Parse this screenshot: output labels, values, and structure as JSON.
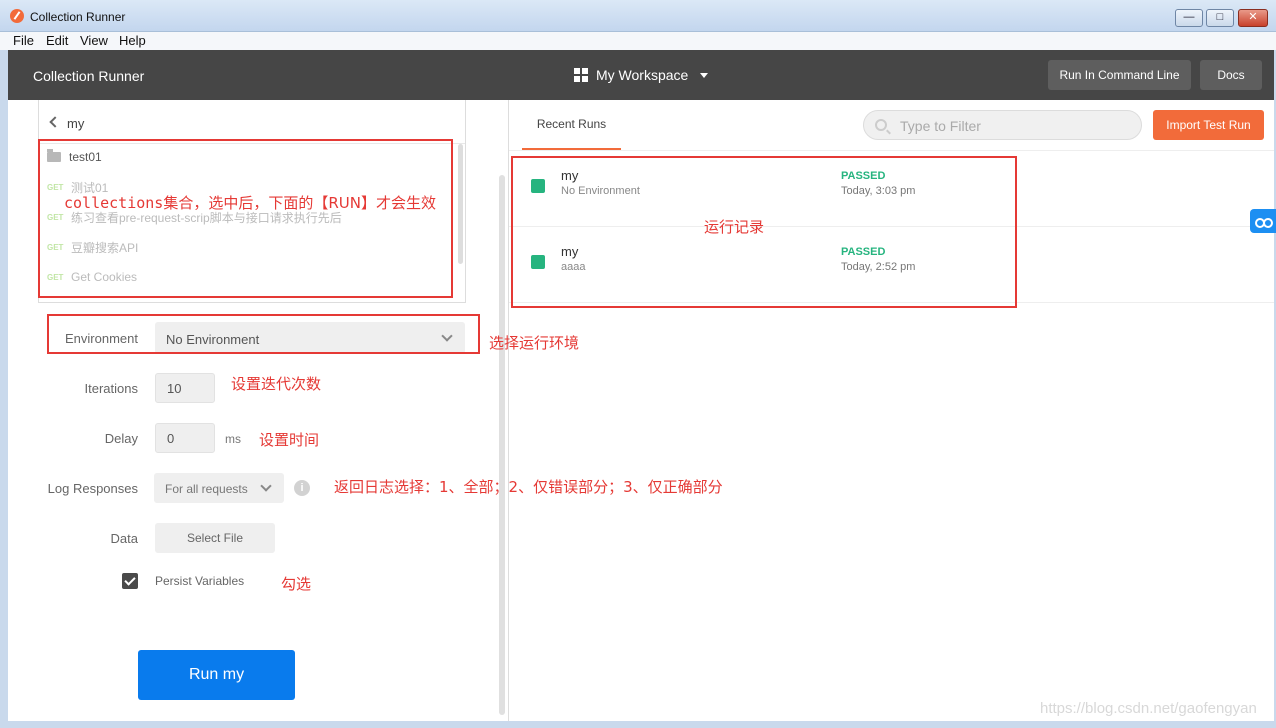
{
  "window": {
    "title": "Collection Runner",
    "buttons": {
      "minimize": "—",
      "maximize": "□",
      "close": "✕"
    }
  },
  "menu": [
    "File",
    "Edit",
    "View",
    "Help"
  ],
  "header": {
    "title": "Collection Runner",
    "workspace": "My Workspace",
    "run_cmd_label": "Run In Command Line",
    "docs_label": "Docs"
  },
  "collection": {
    "back_label": "my",
    "folder": "test01",
    "requests": [
      {
        "method": "GET",
        "name": "测试01"
      },
      {
        "method": "GET",
        "name": "练习查看pre-request-scrip脚本与接口请求执行先后"
      },
      {
        "method": "GET",
        "name": "豆瓣搜索API"
      },
      {
        "method": "GET",
        "name": "Get Cookies"
      }
    ]
  },
  "form": {
    "environment_label": "Environment",
    "environment_value": "No Environment",
    "iterations_label": "Iterations",
    "iterations_value": "10",
    "delay_label": "Delay",
    "delay_value": "0",
    "delay_unit": "ms",
    "log_label": "Log Responses",
    "log_value": "For all requests",
    "info": "i",
    "data_label": "Data",
    "data_button": "Select File",
    "persist_label": "Persist Variables",
    "persist_checked": true,
    "run_button": "Run my"
  },
  "recent": {
    "tab_label": "Recent Runs",
    "filter_placeholder": "Type to Filter",
    "import_label": "Import Test Run",
    "runs": [
      {
        "name": "my",
        "env": "No Environment",
        "status": "PASSED",
        "time": "Today, 3:03 pm"
      },
      {
        "name": "my",
        "env": "aaaa",
        "status": "PASSED",
        "time": "Today, 2:52 pm"
      }
    ]
  },
  "annotations": {
    "collections_prefix": "collections",
    "collections_rest": "集合，选中后，下面的【RUN】才会生效",
    "env": "选择运行环境",
    "iterations": "设置迭代次数",
    "delay": "设置时间",
    "log": "返回日志选择：1、全部；2、仅错误部分；3、仅正确部分",
    "persist": "勾选",
    "runs": "运行记录"
  },
  "watermark": "https://blog.csdn.net/gaofengyan",
  "colors": {
    "accent": "#f26b3a",
    "primary": "#097bed",
    "pass": "#26b47f",
    "annotation": "#e53935",
    "header": "#464646"
  }
}
